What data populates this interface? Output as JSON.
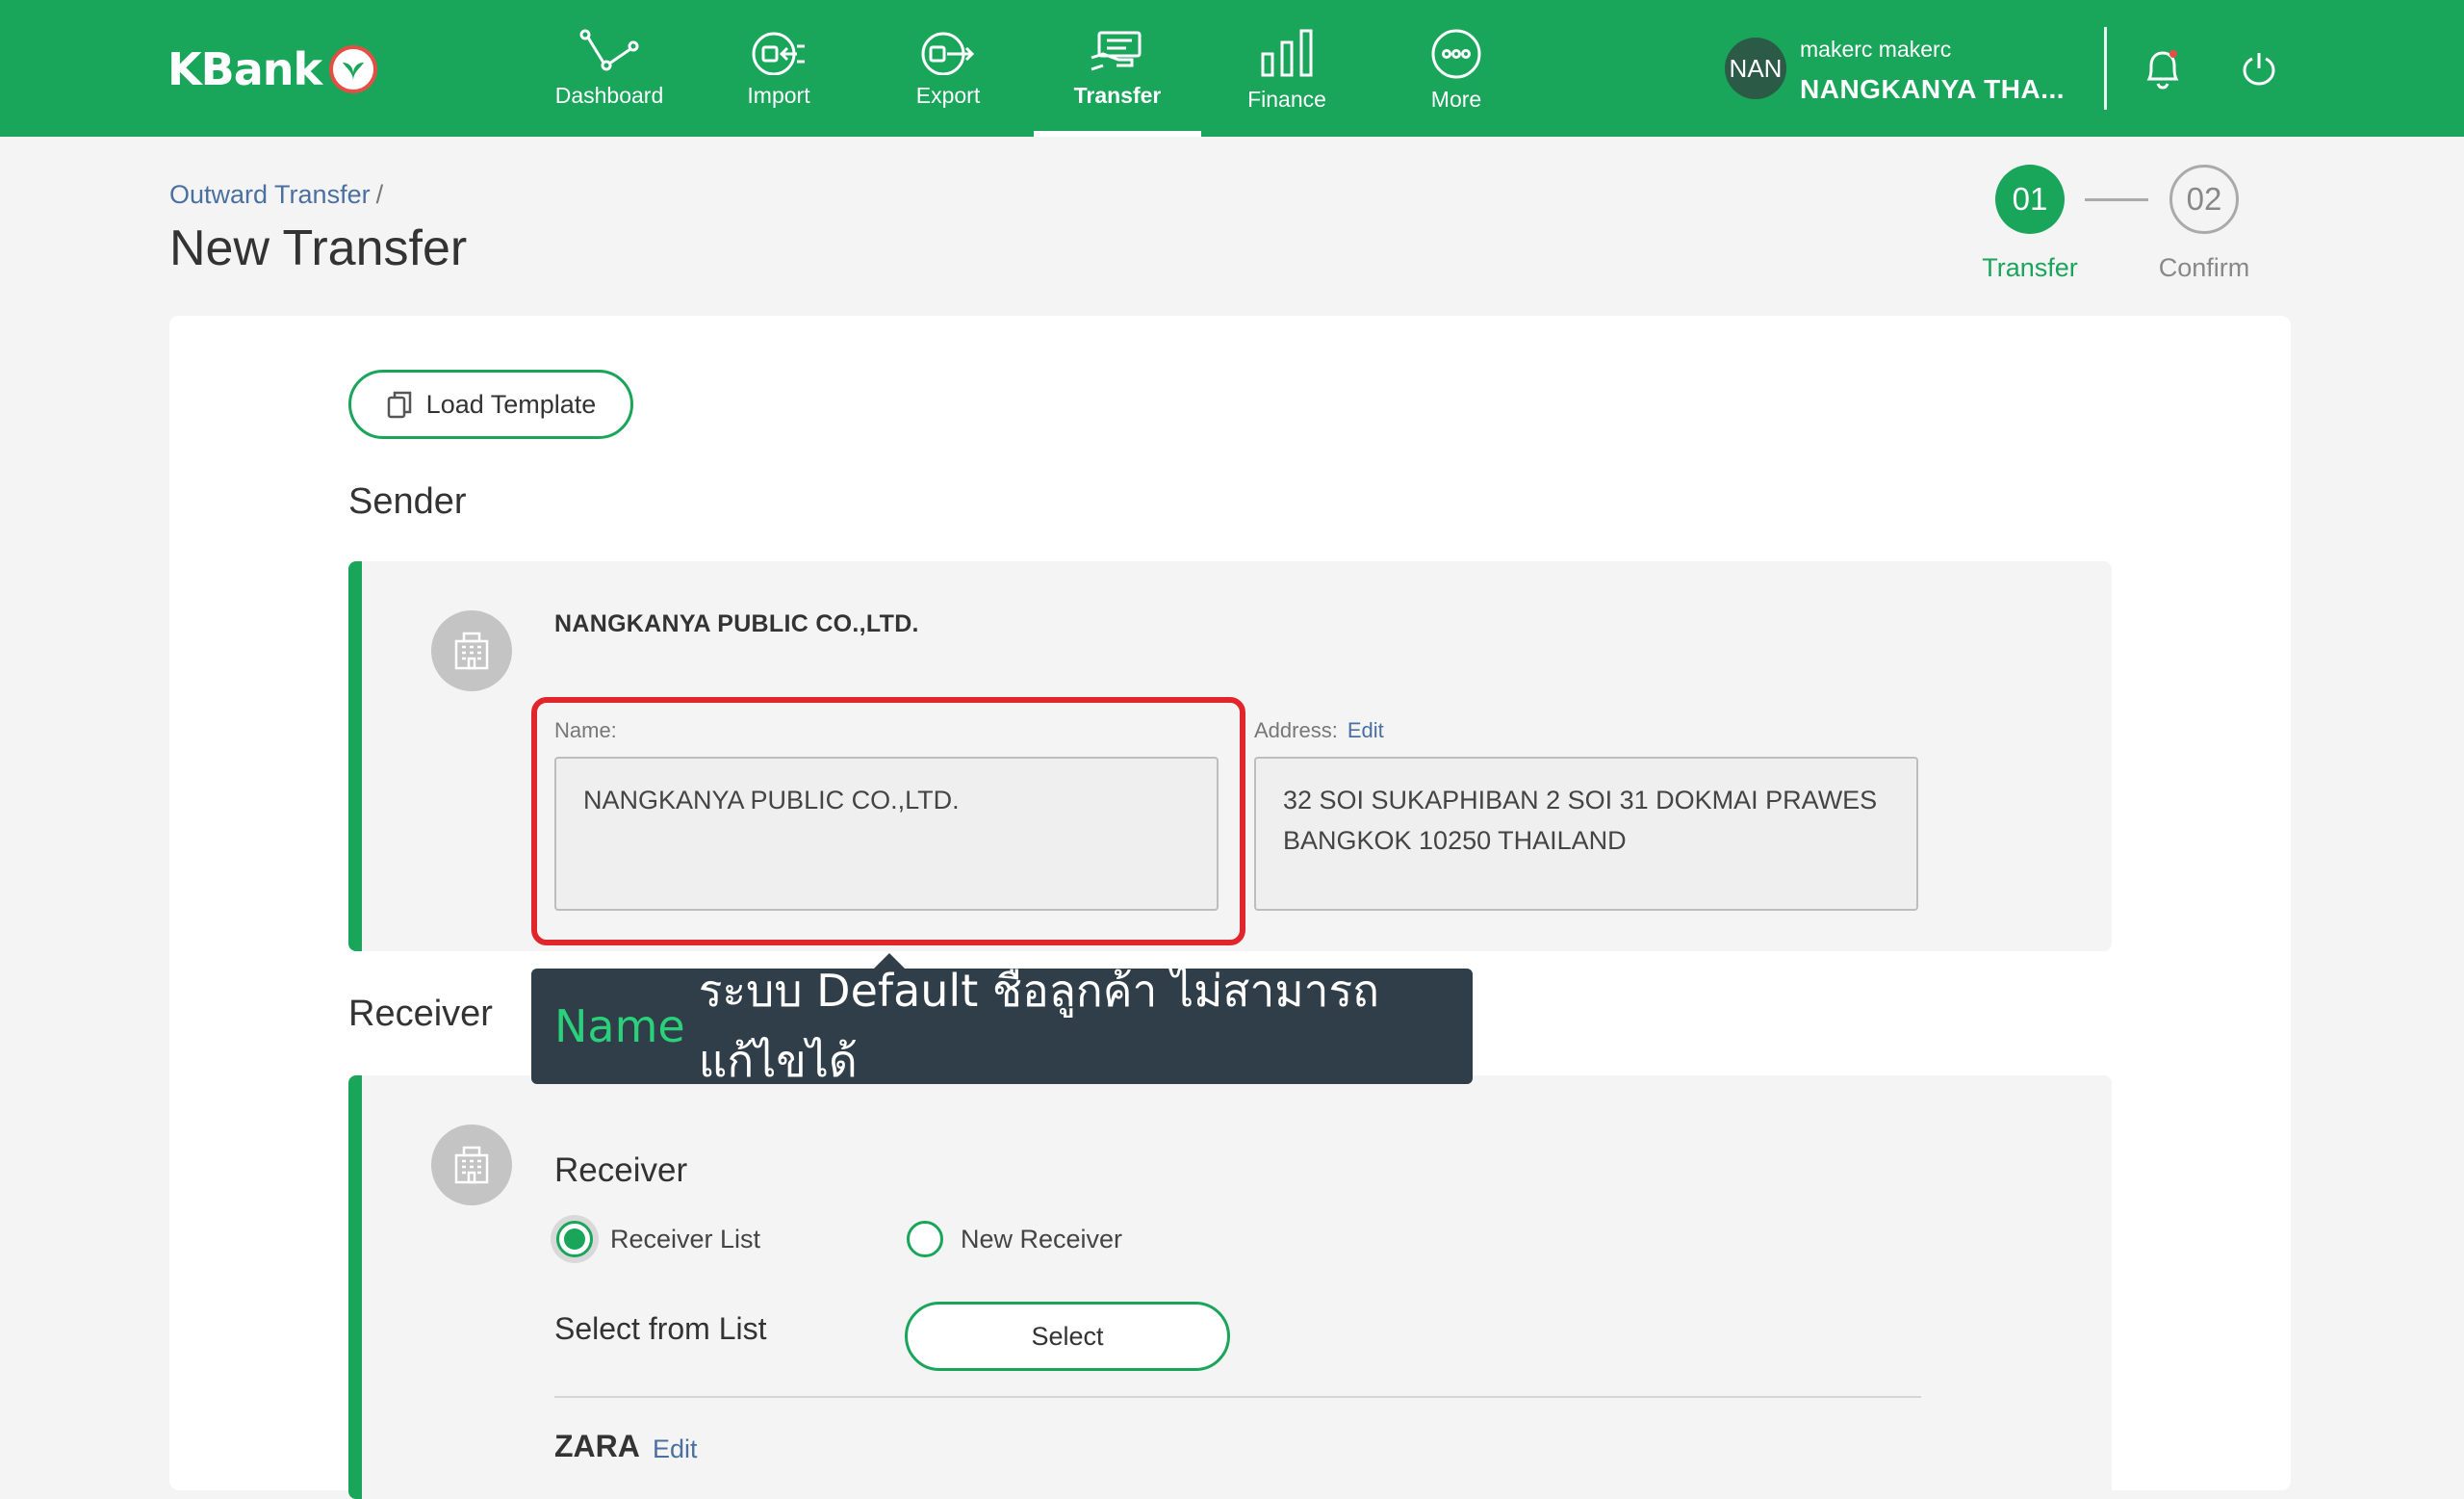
{
  "brand": {
    "logo_text": "KBank"
  },
  "nav": {
    "items": [
      {
        "label": "Dashboard",
        "icon": "dashboard-icon"
      },
      {
        "label": "Import",
        "icon": "import-icon"
      },
      {
        "label": "Export",
        "icon": "export-icon"
      },
      {
        "label": "Transfer",
        "icon": "transfer-icon",
        "active": true
      },
      {
        "label": "Finance",
        "icon": "finance-icon"
      },
      {
        "label": "More",
        "icon": "more-icon"
      }
    ]
  },
  "user": {
    "initials": "NAN",
    "username": "makerc makerc",
    "company_short": "NANGKANYA THA..."
  },
  "header": {
    "breadcrumb": "Outward Transfer",
    "breadcrumb_sep": "/",
    "title": "New Transfer"
  },
  "stepper": {
    "steps": [
      {
        "number": "01",
        "label": "Transfer",
        "state": "active"
      },
      {
        "number": "02",
        "label": "Confirm",
        "state": "pending"
      }
    ]
  },
  "toolbar": {
    "load_template_label": "Load Template"
  },
  "sender": {
    "section_title": "Sender",
    "company": "NANGKANYA PUBLIC CO.,LTD.",
    "name_label": "Name:",
    "name_value": "NANGKANYA PUBLIC CO.,LTD.",
    "address_label": "Address:",
    "address_edit": "Edit",
    "address_line1": "32 SOI SUKAPHIBAN 2 SOI 31 DOKMAI PRAWES",
    "address_line2": "BANGKOK 10250 THAILAND"
  },
  "tooltip": {
    "highlight": "Name",
    "text": "ระบบ Default ชื่อลูกค้า ไม่สามารถแก้ไขได้"
  },
  "receiver": {
    "section_title": "Receiver",
    "heading": "Receiver",
    "options": [
      {
        "label": "Receiver List",
        "checked": true
      },
      {
        "label": "New Receiver",
        "checked": false
      }
    ],
    "select_label": "Select from List",
    "select_button": "Select",
    "name": "ZARA",
    "edit": "Edit"
  },
  "colors": {
    "brand_green": "#19a55a",
    "highlight_red": "#e0262b",
    "tooltip_bg": "#2f3e48",
    "link_blue": "#4a6fa0"
  }
}
